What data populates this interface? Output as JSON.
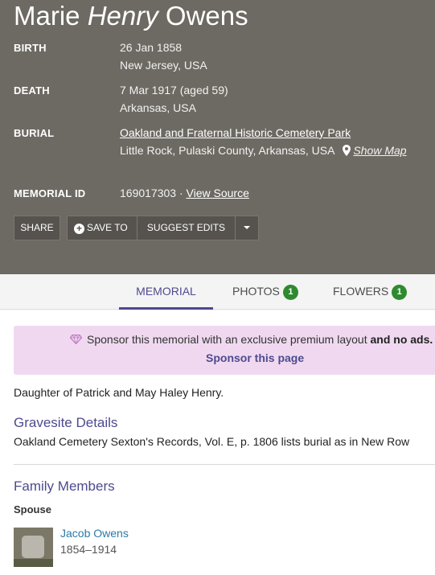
{
  "person": {
    "first": "Marie",
    "middle": "Henry",
    "last": "Owens"
  },
  "facts": {
    "birth_label": "BIRTH",
    "birth_date": "26 Jan 1858",
    "birth_place": "New Jersey, USA",
    "death_label": "DEATH",
    "death_date": "7 Mar 1917 (aged 59)",
    "death_place": "Arkansas, USA",
    "burial_label": "BURIAL",
    "burial_cemetery": "Oakland and Fraternal Historic Cemetery Park",
    "burial_place": "Little Rock, Pulaski County, Arkansas, USA",
    "show_map": "Show Map",
    "memorial_id_label": "MEMORIAL ID",
    "memorial_id": "169017303",
    "separator": " · ",
    "view_source": "View Source"
  },
  "actions": {
    "share": "SHARE",
    "save_to": "SAVE TO",
    "suggest_edits": "SUGGEST EDITS"
  },
  "tabs": [
    {
      "label": "MEMORIAL"
    },
    {
      "label": "PHOTOS",
      "count": "1"
    },
    {
      "label": "FLOWERS",
      "count": "1"
    }
  ],
  "sponsor": {
    "text": "Sponsor this memorial with an exclusive premium layout",
    "bold": "and no ads.",
    "link": "Sponsor this page"
  },
  "bio": "Daughter of Patrick and May Haley Henry.",
  "gravesite": {
    "heading": "Gravesite Details",
    "text": "Oakland Cemetery Sexton's Records, Vol. E, p. 1806 lists burial as in New Row"
  },
  "family": {
    "heading": "Family Members",
    "spouse_label": "Spouse",
    "spouse_name": "Jacob Owens",
    "spouse_dates": "1854–1914"
  },
  "colors": {
    "hero_bg": "#6d6a63",
    "accent": "#4d4a8e",
    "badge": "#2f8a2f",
    "sponsor_bg": "#f0d9f0",
    "link": "#2a7aa8"
  },
  "icons": {
    "map_pin": "map-pin-icon",
    "plus": "plus-circle-icon",
    "dropdown": "caret-down-icon",
    "gem": "diamond-icon"
  }
}
